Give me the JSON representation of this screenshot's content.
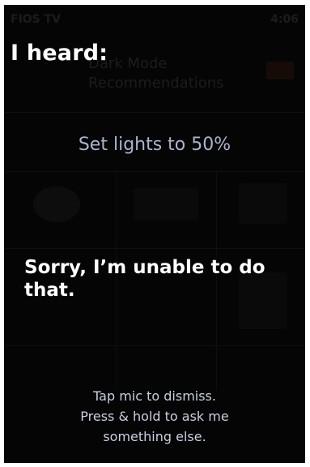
{
  "background": {
    "status_left": "FIOS TV",
    "status_right": "4:06",
    "title_lines": [
      "Dark Mode",
      "Recommendations"
    ]
  },
  "overlay": {
    "heard_label": "I heard:",
    "heard_text": "Set lights to 50%",
    "response_text": "Sorry, I’m unable to do that.",
    "hint_lines": [
      "Tap mic to dismiss.",
      "Press & hold to ask me",
      "something else."
    ]
  },
  "colors": {
    "background": "#050505",
    "heard_text": "#aab4cf",
    "primary_text": "#ffffff",
    "hint_text": "#c8cfe0"
  }
}
